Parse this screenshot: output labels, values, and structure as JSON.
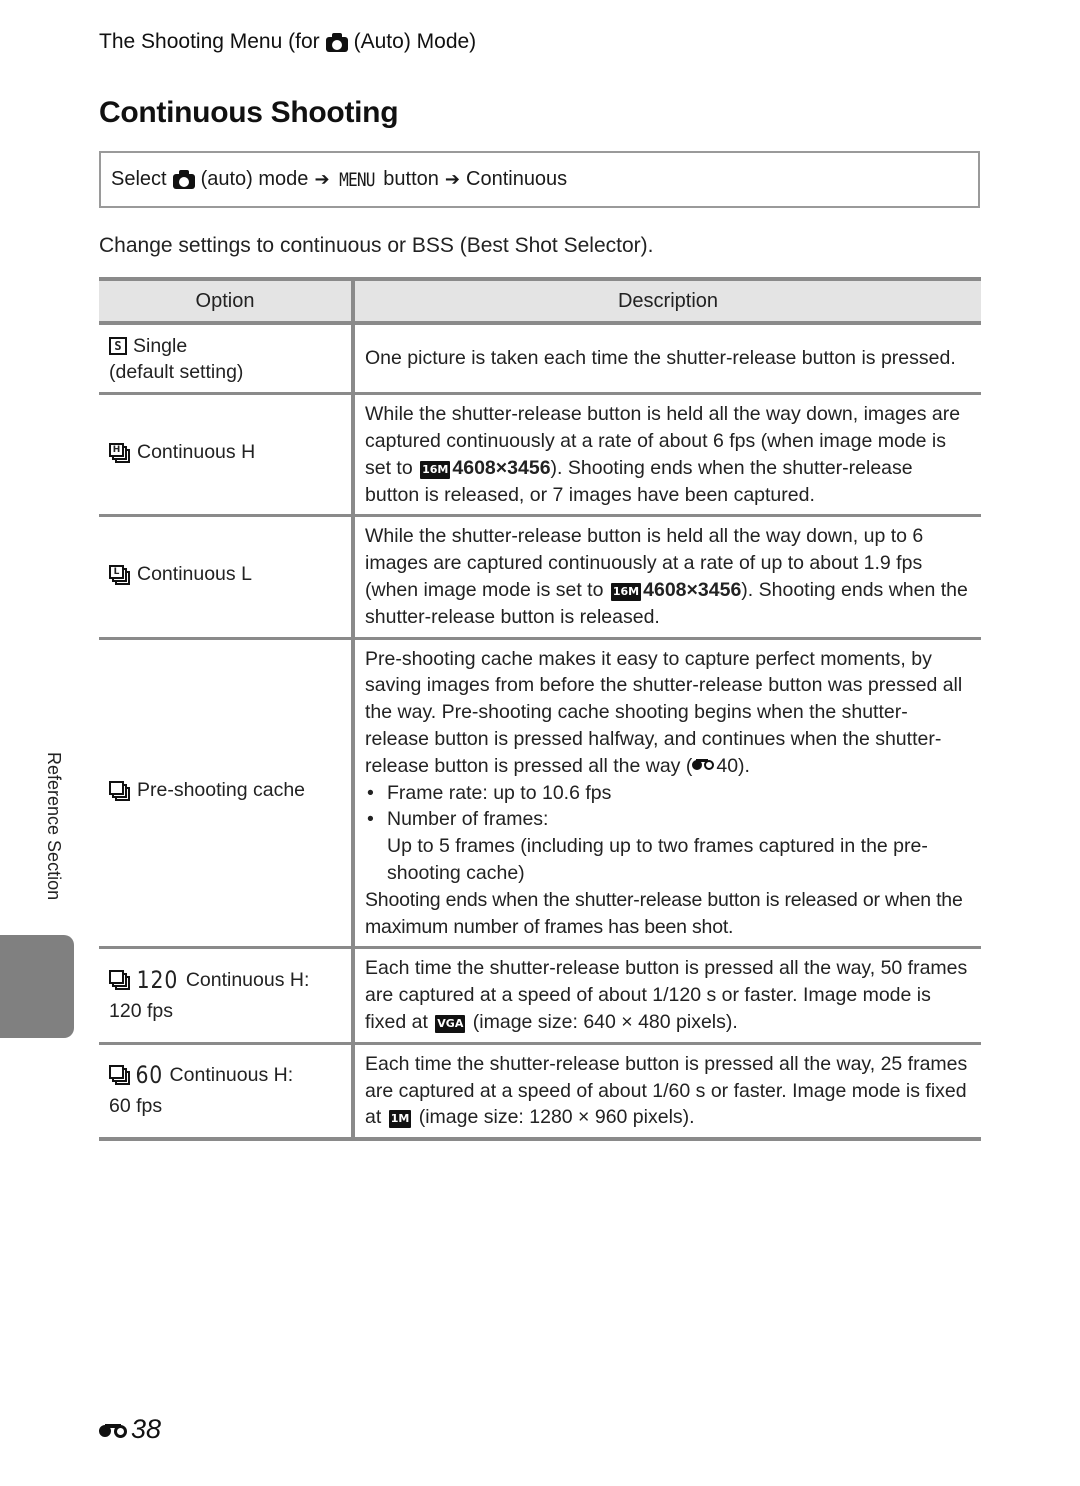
{
  "header": {
    "section_prefix": "The Shooting Menu (for",
    "section_suffix": "(Auto) Mode)",
    "page_title": "Continuous Shooting"
  },
  "path": {
    "select": "Select",
    "mode": "(auto) mode",
    "arrow": "➔",
    "menu_glyph": "MENU",
    "button": "button",
    "target": "Continuous"
  },
  "intro": "Change settings to continuous or BSS (Best Shot Selector).",
  "table": {
    "headers": {
      "option": "Option",
      "description": "Description"
    },
    "rows": [
      {
        "icon": "single-icon",
        "icon_glyph": "S",
        "option": "Single",
        "option_note": "(default setting)",
        "description": "One picture is taken each time the shutter-release button is pressed."
      },
      {
        "icon": "continuous-h-icon",
        "icon_glyph": "H",
        "option": "Continuous H",
        "desc_before": "While the shutter-release button is held all the way down, images are captured continuously at a rate of about 6 fps (when image mode is set to",
        "badge": "16M",
        "size": "4608×3456",
        "desc_after": "). Shooting ends when the shutter-release button is released, or 7 images have been captured."
      },
      {
        "icon": "continuous-l-icon",
        "icon_glyph": "L",
        "option": "Continuous L",
        "desc_before": "While the shutter-release button is held all the way down, up to 6 images are captured continuously at a rate of up to about 1.9 fps (when image mode is set to",
        "badge": "16M",
        "size": "4608×3456",
        "desc_after": "). Shooting ends when the shutter-release button is released."
      },
      {
        "icon": "pre-shooting-cache-icon",
        "option": "Pre-shooting cache",
        "desc_intro": "Pre-shooting cache makes it easy to capture perfect moments, by saving images from before the shutter-release button was pressed all the way. Pre-shooting cache shooting begins when the shutter-release button is pressed halfway, and continues when the shutter-release button is pressed all the way (",
        "ref_page": "40",
        "desc_intro_end": ").",
        "bullets": [
          "Frame rate: up to 10.6 fps",
          "Number of frames:"
        ],
        "bullet_detail": "Up to 5 frames (including up to two frames captured in the pre-shooting cache)",
        "desc_outro": "Shooting ends when the shutter-release button is released or when the maximum number of frames has been shot."
      },
      {
        "icon": "continuous-h-120-icon",
        "icon_num": "120",
        "option": "Continuous H:",
        "option_note": "120 fps",
        "desc_line1": "Each time the shutter-release button is pressed all the way, 50 frames are captured at a speed of about 1/120 s or faster.",
        "desc_before": "Image mode is fixed at",
        "badge": "VGA",
        "desc_after": "(image size: 640 × 480 pixels)."
      },
      {
        "icon": "continuous-h-60-icon",
        "icon_num": "60",
        "option": "Continuous H:",
        "option_note": "60 fps",
        "desc_line1": "Each time the shutter-release button is pressed all the way, 25 frames are captured at a speed of about 1/60 s or faster.",
        "desc_before": "Image mode is fixed at",
        "badge": "1M",
        "desc_after": "(image size: 1280 × 960 pixels)."
      }
    ]
  },
  "side_tab": {
    "label": "Reference Section",
    "color": "#808080"
  },
  "footer": {
    "page_number": "38"
  }
}
